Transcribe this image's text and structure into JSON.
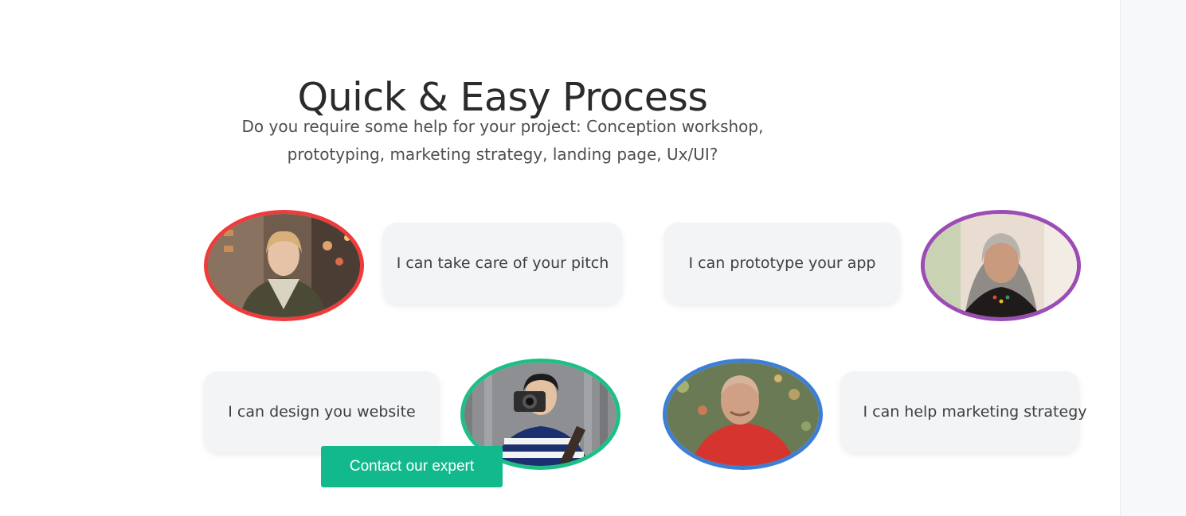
{
  "section": {
    "title": "Quick & Easy Process",
    "subtitle_line1": "Do you require some help for your project: Conception workshop,",
    "subtitle_line2": "prototyping, marketing strategy, landing page, Ux/UI?"
  },
  "experts": [
    {
      "card_text": "I can take care of your pitch",
      "ring_color": "#ef3b3b",
      "photo": "woman-with-scarf-photo"
    },
    {
      "card_text": "I can prototype your app",
      "ring_color": "#9b4db5",
      "photo": "older-woman-photo"
    },
    {
      "card_text": "I can design you website",
      "ring_color": "#1dbf84",
      "photo": "man-with-camera-photo"
    },
    {
      "card_text": "I can help marketing strategy",
      "ring_color": "#3d7fd6",
      "photo": "man-in-red-shirt-photo"
    }
  ],
  "cta": {
    "label": "Contact our expert",
    "color": "#12b98d"
  },
  "colors": {
    "card_bg": "#f3f4f6",
    "title": "#2b2b2b",
    "text": "#4e4e4e"
  }
}
